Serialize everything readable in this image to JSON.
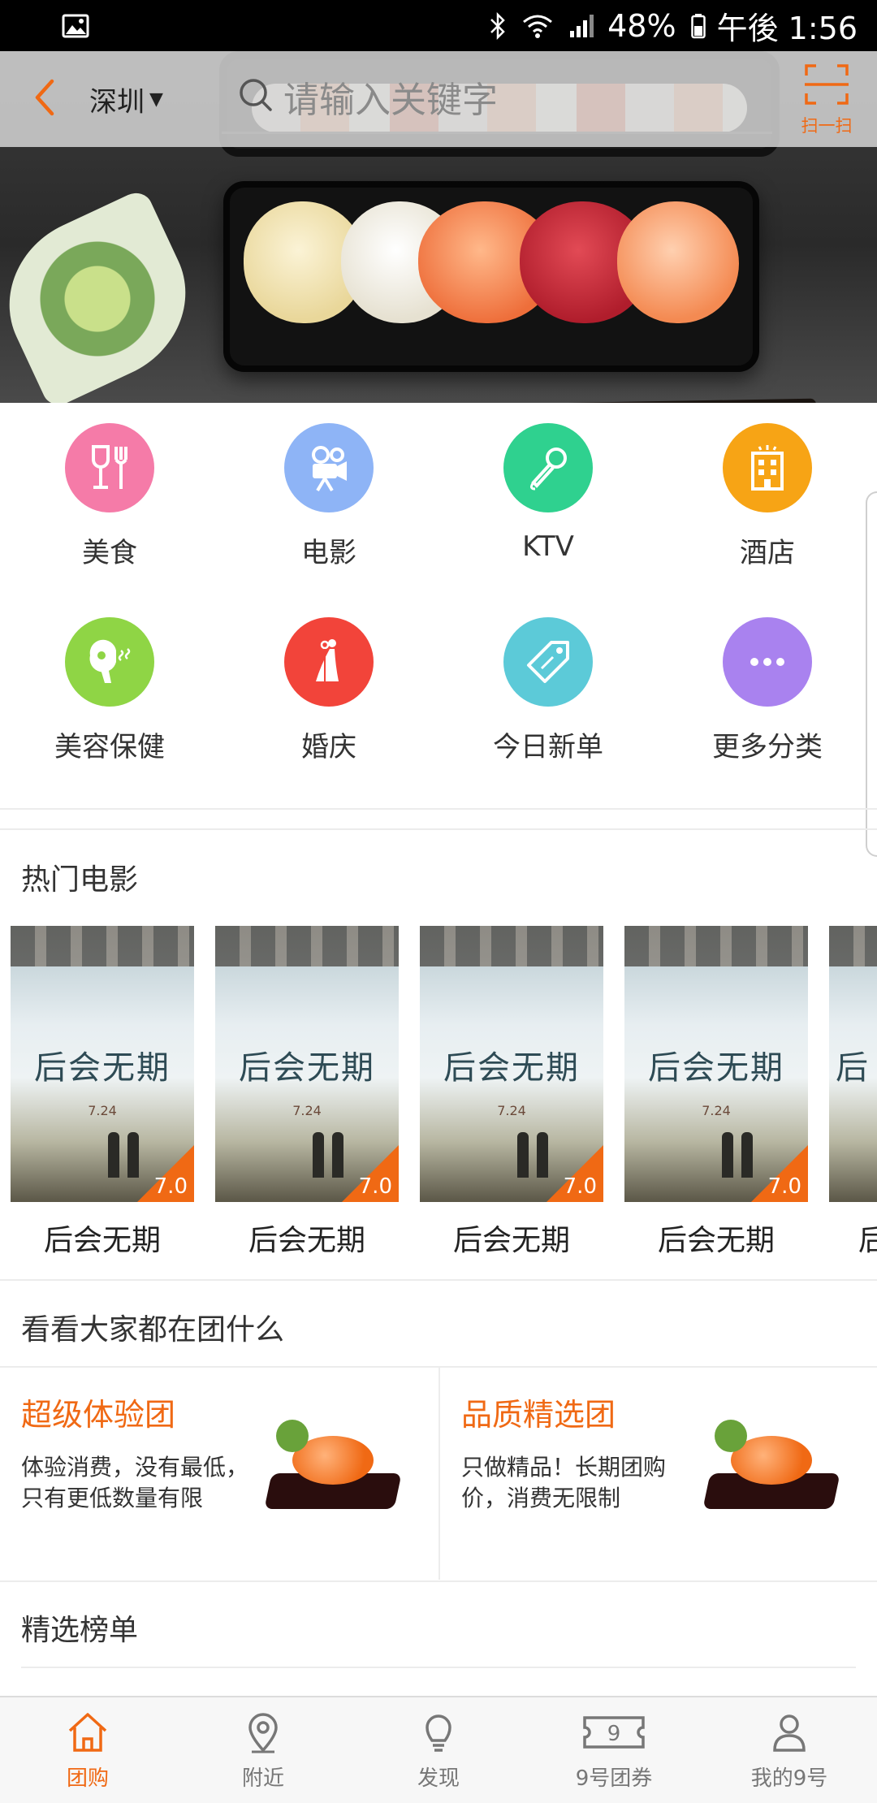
{
  "status_bar": {
    "battery": "48%",
    "time": "午後 1:56"
  },
  "header": {
    "city": "深圳",
    "search_placeholder": "请输入关键字",
    "scan_label": "扫一扫"
  },
  "banner": {
    "slide_count": 3,
    "active_index": 0
  },
  "categories": [
    {
      "label": "美食",
      "icon": "wine-fork-icon",
      "color": "#f57ba8"
    },
    {
      "label": "电影",
      "icon": "film-camera-icon",
      "color": "#8eb4f6"
    },
    {
      "label": "KTV",
      "icon": "microphone-icon",
      "color": "#2fd18f"
    },
    {
      "label": "酒店",
      "icon": "hotel-building-icon",
      "color": "#f7a415"
    },
    {
      "label": "美容保健",
      "icon": "hair-dryer-icon",
      "color": "#8fd545"
    },
    {
      "label": "婚庆",
      "icon": "wedding-couple-icon",
      "color": "#f2443a"
    },
    {
      "label": "今日新单",
      "icon": "price-tag-icon",
      "color": "#5ccad8"
    },
    {
      "label": "更多分类",
      "icon": "more-dots-icon",
      "color": "#a982ef"
    }
  ],
  "hot_movies": {
    "title": "热门电影",
    "items": [
      {
        "name": "后会无期",
        "poster_title": "后会无期",
        "poster_date": "7.24",
        "score": "7.0"
      },
      {
        "name": "后会无期",
        "poster_title": "后会无期",
        "poster_date": "7.24",
        "score": "7.0"
      },
      {
        "name": "后会无期",
        "poster_title": "后会无期",
        "poster_date": "7.24",
        "score": "7.0"
      },
      {
        "name": "后会无期",
        "poster_title": "后会无期",
        "poster_date": "7.24",
        "score": "7.0"
      },
      {
        "name": "后",
        "poster_title": "后",
        "poster_date": "",
        "score": ""
      }
    ]
  },
  "group_section": {
    "title": "看看大家都在团什么",
    "cards": [
      {
        "title": "超级体验团",
        "desc": "体验消费，没有最低，只有更低数量有限"
      },
      {
        "title": "品质精选团",
        "desc": "只做精品！长期团购价，消费无限制"
      }
    ]
  },
  "ranking": {
    "title": "精选榜单"
  },
  "bottom_nav": [
    {
      "label": "团购",
      "icon": "home-icon",
      "active": true
    },
    {
      "label": "附近",
      "icon": "location-pin-icon",
      "active": false
    },
    {
      "label": "发现",
      "icon": "lightbulb-icon",
      "active": false
    },
    {
      "label": "9号团券",
      "icon": "ticket-9-icon",
      "active": false
    },
    {
      "label": "我的9号",
      "icon": "user-icon",
      "active": false
    }
  ],
  "colors": {
    "accent": "#f06914"
  }
}
